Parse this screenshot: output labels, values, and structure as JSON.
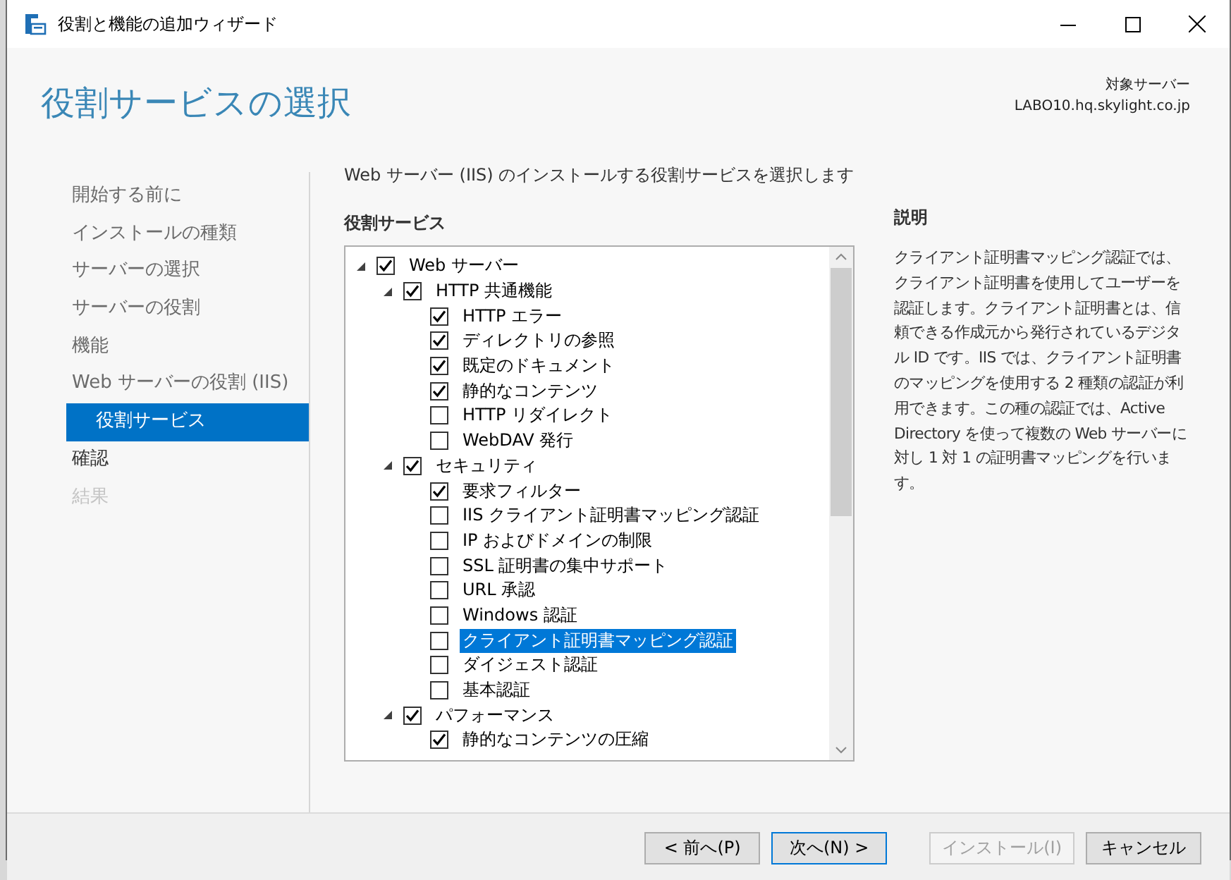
{
  "window": {
    "title": "役割と機能の追加ウィザード"
  },
  "header": {
    "title": "役割サービスの選択",
    "target_label": "対象サーバー",
    "target_server": "LABO10.hq.skylight.co.jp"
  },
  "steps": [
    {
      "label": "開始する前に",
      "visited": true,
      "selected": false,
      "disabled": false
    },
    {
      "label": "インストールの種類",
      "visited": true,
      "selected": false,
      "disabled": false
    },
    {
      "label": "サーバーの選択",
      "visited": true,
      "selected": false,
      "disabled": false
    },
    {
      "label": "サーバーの役割",
      "visited": true,
      "selected": false,
      "disabled": false
    },
    {
      "label": "機能",
      "visited": true,
      "selected": false,
      "disabled": false
    },
    {
      "label": "Web サーバーの役割 (IIS)",
      "visited": true,
      "selected": false,
      "disabled": false
    },
    {
      "label": "役割サービス",
      "visited": true,
      "selected": true,
      "disabled": false,
      "sub": true
    },
    {
      "label": "確認",
      "visited": false,
      "selected": false,
      "disabled": false
    },
    {
      "label": "結果",
      "visited": false,
      "selected": false,
      "disabled": true
    }
  ],
  "instruction": "Web サーバー (IIS) のインストールする役割サービスを選択します",
  "tree_heading": "役割サービス",
  "tree": [
    {
      "label": "Web サーバー",
      "checked": true,
      "expanded": true,
      "selected": false,
      "children": [
        {
          "label": "HTTP 共通機能",
          "checked": true,
          "expanded": true,
          "selected": false,
          "children": [
            {
              "label": "HTTP エラー",
              "checked": true,
              "selected": false
            },
            {
              "label": "ディレクトリの参照",
              "checked": true,
              "selected": false
            },
            {
              "label": "既定のドキュメント",
              "checked": true,
              "selected": false
            },
            {
              "label": "静的なコンテンツ",
              "checked": true,
              "selected": false
            },
            {
              "label": "HTTP リダイレクト",
              "checked": false,
              "selected": false
            },
            {
              "label": "WebDAV 発行",
              "checked": false,
              "selected": false
            }
          ]
        },
        {
          "label": "セキュリティ",
          "checked": true,
          "expanded": true,
          "selected": false,
          "children": [
            {
              "label": "要求フィルター",
              "checked": true,
              "selected": false
            },
            {
              "label": "IIS クライアント証明書マッピング認証",
              "checked": false,
              "selected": false
            },
            {
              "label": "IP およびドメインの制限",
              "checked": false,
              "selected": false
            },
            {
              "label": "SSL 証明書の集中サポート",
              "checked": false,
              "selected": false
            },
            {
              "label": "URL 承認",
              "checked": false,
              "selected": false
            },
            {
              "label": "Windows 認証",
              "checked": false,
              "selected": false
            },
            {
              "label": "クライアント証明書マッピング認証",
              "checked": false,
              "selected": true
            },
            {
              "label": "ダイジェスト認証",
              "checked": false,
              "selected": false
            },
            {
              "label": "基本認証",
              "checked": false,
              "selected": false
            }
          ]
        },
        {
          "label": "パフォーマンス",
          "checked": true,
          "expanded": true,
          "selected": false,
          "children": [
            {
              "label": "静的なコンテンツの圧縮",
              "checked": true,
              "selected": false
            }
          ]
        }
      ]
    }
  ],
  "description": {
    "heading": "説明",
    "text": "クライアント証明書マッピング認証では、クライアント証明書を使用してユーザーを認証します。クライアント証明書とは、信頼できる作成元から発行されているデジタル ID です。IIS では、クライアント証明書のマッピングを使用する 2 種類の認証が利用できます。この種の認証では、Active Directory を使って複数の Web サーバーに対し 1 対 1 の証明書マッピングを行います。"
  },
  "buttons": [
    {
      "label": "< 前へ(P)",
      "disabled": false,
      "default": false
    },
    {
      "label": "次へ(N) >",
      "disabled": false,
      "default": true
    },
    {
      "label": "インストール(I)",
      "disabled": true,
      "default": false
    },
    {
      "label": "キャンセル",
      "disabled": false,
      "default": false
    }
  ]
}
